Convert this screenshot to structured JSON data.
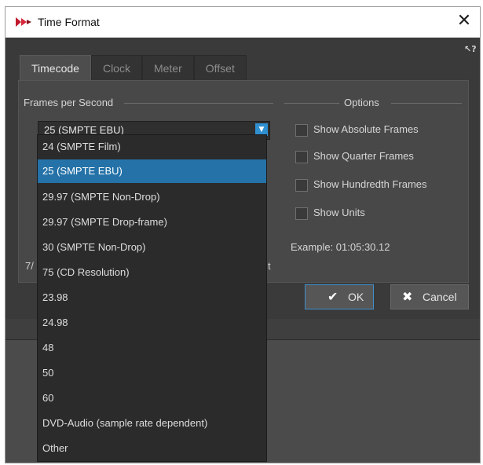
{
  "window": {
    "title": "Time Format",
    "close_label": "✕",
    "help_label": "↖?"
  },
  "tabs": [
    {
      "label": "Timecode",
      "active": true
    },
    {
      "label": "Clock",
      "active": false
    },
    {
      "label": "Meter",
      "active": false
    },
    {
      "label": "Offset",
      "active": false
    }
  ],
  "frames": {
    "group_label": "Frames per Second",
    "selected_value": "25 (SMPTE EBU)",
    "options": [
      "24 (SMPTE Film)",
      "25 (SMPTE EBU)",
      "29.97 (SMPTE Non-Drop)",
      "29.97 (SMPTE Drop-frame)",
      "30 (SMPTE Non-Drop)",
      "75 (CD Resolution)",
      "23.98",
      "24.98",
      "48",
      "50",
      "60",
      "DVD-Audio (sample rate dependent)",
      "Other"
    ],
    "highlighted_index": 1
  },
  "options_group": {
    "label": "Options",
    "checkboxes": [
      {
        "label": "Show Absolute Frames",
        "checked": false
      },
      {
        "label": "Show Quarter Frames",
        "checked": false
      },
      {
        "label": "Show Hundredth Frames",
        "checked": false
      },
      {
        "label": "Show Units",
        "checked": false
      }
    ],
    "example": "Example: 01:05:30.12"
  },
  "partial_text": {
    "left": "7/",
    "right": "t"
  },
  "buttons": {
    "ok": "OK",
    "cancel": "Cancel"
  },
  "colors": {
    "accent": "#2472a8",
    "dialog_bg": "#3a3a3a",
    "list_bg": "#2b2b2b"
  },
  "icons": {
    "app": "wavelab-logo-icon",
    "ok": "check-icon",
    "cancel": "x-icon"
  }
}
